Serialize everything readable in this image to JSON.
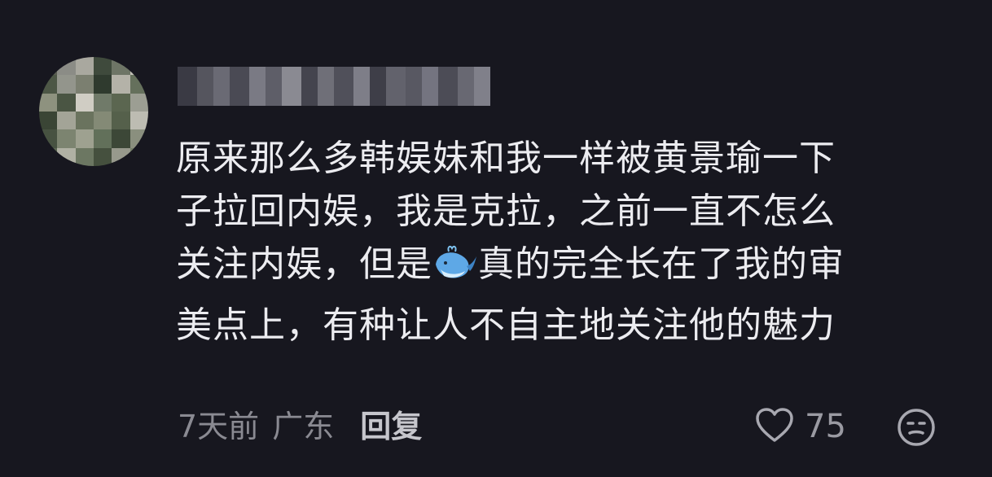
{
  "comment": {
    "lines": [
      "原来那么多韩娱妹和我一样被黄景瑜一下",
      "子拉回内娱，我是克拉，之前一直不怎么",
      "关注内娱，但是",
      "真的完全长在了我的审",
      "美点上，有种让人不自主地关注他的魅力"
    ],
    "emoji_icon": "whale-icon"
  },
  "meta": {
    "time": "7天前",
    "location": "广东",
    "reply_label": "回复"
  },
  "actions": {
    "like_count": "75",
    "like_icon": "heart-outline-icon",
    "dislike_icon": "meh-face-icon"
  },
  "colors": {
    "background": "#17171f",
    "text": "#ececf0",
    "meta_text": "#8a8a92",
    "reply_text": "#c6c6cc"
  }
}
